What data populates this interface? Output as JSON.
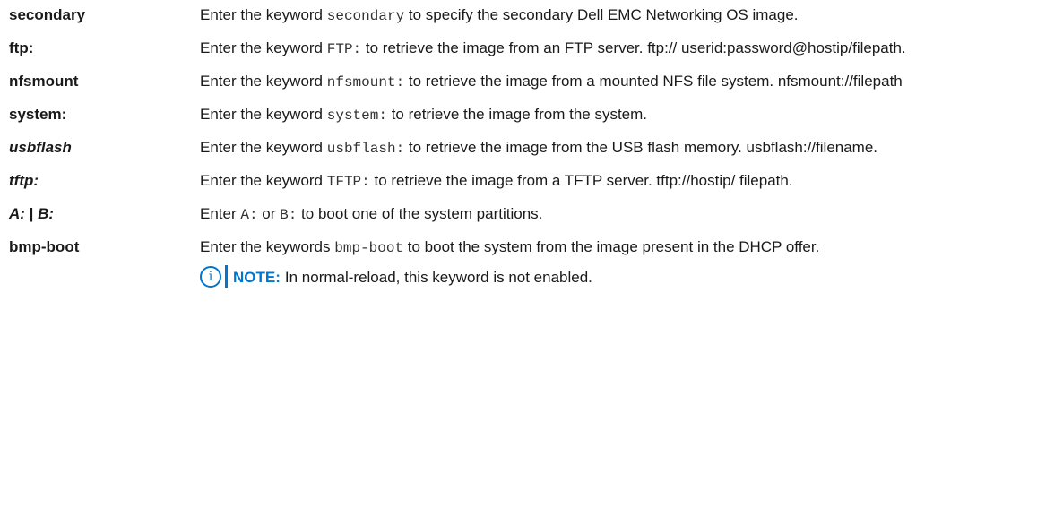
{
  "rows": [
    {
      "term": "secondary",
      "pre": "Enter the keyword ",
      "code": "secondary",
      "post": " to specify the secondary Dell EMC Networking OS image."
    },
    {
      "term": "ftp:",
      "pre": "Enter the keyword ",
      "code": "FTP:",
      "post": " to retrieve the image from an FTP server. ftp:// userid:password@hostip/filepath."
    },
    {
      "term": "nfsmount",
      "pre": "Enter the keyword ",
      "code": "nfsmount:",
      "post": " to retrieve the image from a mounted NFS file system. nfsmount://filepath"
    },
    {
      "term": "system:",
      "pre": "Enter the keyword ",
      "code": "system:",
      "post": " to retrieve the image from the system."
    },
    {
      "term": "usbflash",
      "pre": "Enter the keyword ",
      "code": "usbflash:",
      "post": " to retrieve the image from the USB flash memory. usbflash://filename."
    },
    {
      "term": "tftp:",
      "pre": "Enter the keyword ",
      "code": "TFTP:",
      "post": " to retrieve the image from a TFTP server. tftp://hostip/ filepath."
    },
    {
      "term_a": "A:",
      "term_sep": " | ",
      "term_b": "B:",
      "pre": "Enter ",
      "code_a": "A:",
      "mid": " or ",
      "code_b": "B:",
      "post": " to boot one of the system partitions."
    },
    {
      "term": "bmp-boot",
      "pre": "Enter the keywords ",
      "code": "bmp-boot",
      "post": " to boot the system from the image present in the DHCP offer.",
      "note_icon": "i",
      "note_label": "NOTE:",
      "note_text": "In normal-reload, this keyword is not enabled."
    }
  ],
  "colors": {
    "note_accent": "#0076ce",
    "text": "#1a1a1a"
  },
  "icons": {
    "note": "info-icon"
  }
}
